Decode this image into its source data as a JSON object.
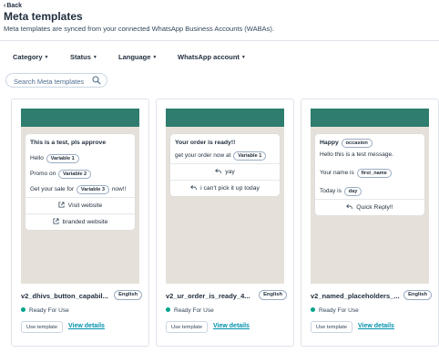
{
  "header": {
    "back_label": "Back",
    "title": "Meta templates",
    "subtitle": "Meta templates are synced from your connected WhatsApp Business Accounts (WABAs)."
  },
  "filters": [
    {
      "label": "Category"
    },
    {
      "label": "Status"
    },
    {
      "label": "Language"
    },
    {
      "label": "WhatsApp account"
    }
  ],
  "search": {
    "placeholder": "Search Meta templates"
  },
  "colors": {
    "header_band": "#2e7d6e",
    "preview_bg": "#e5e1da",
    "link": "#0091ae",
    "status_dot": "#00a38d"
  },
  "cards": [
    {
      "bubble": {
        "head": "This is a test, pls approve",
        "hello": "Hello",
        "var1": "Variable 1",
        "promo": "Promo on",
        "var2": "Variable 2",
        "sale_pre": "Get your sale for",
        "var3": "Variable 3",
        "sale_post": "now!!"
      },
      "buttons": [
        {
          "label": "Visit website",
          "icon": "external-link-icon"
        },
        {
          "label": "branded website",
          "icon": "external-link-icon"
        }
      ],
      "name": "v2_dhivs_button_capabil...",
      "language": "English",
      "status": "Ready For Use",
      "use_label": "Use template",
      "details_label": "View details"
    },
    {
      "bubble": {
        "head": "Your order is ready!!",
        "line_pre": "get your order now at",
        "var1": "Variable 1"
      },
      "buttons": [
        {
          "label": "yay",
          "icon": "reply-icon"
        },
        {
          "label": "i can't pick it up today",
          "icon": "reply-icon"
        }
      ],
      "name": "v2_ur_order_is_ready_4...",
      "language": "English",
      "status": "Ready For Use",
      "use_label": "Use template",
      "details_label": "View details"
    },
    {
      "bubble": {
        "head": "Happy",
        "occasion": "occasion",
        "hello": "Hello this is a test message.",
        "name_pre": "Your name is",
        "first_name": "first_name",
        "today_pre": "Today is",
        "day": "day"
      },
      "buttons": [
        {
          "label": "Quick Reply!!",
          "icon": "reply-icon"
        }
      ],
      "name": "v2_named_placeholders_...",
      "language": "English",
      "status": "Ready For Use",
      "use_label": "Use template",
      "details_label": "View details"
    }
  ]
}
